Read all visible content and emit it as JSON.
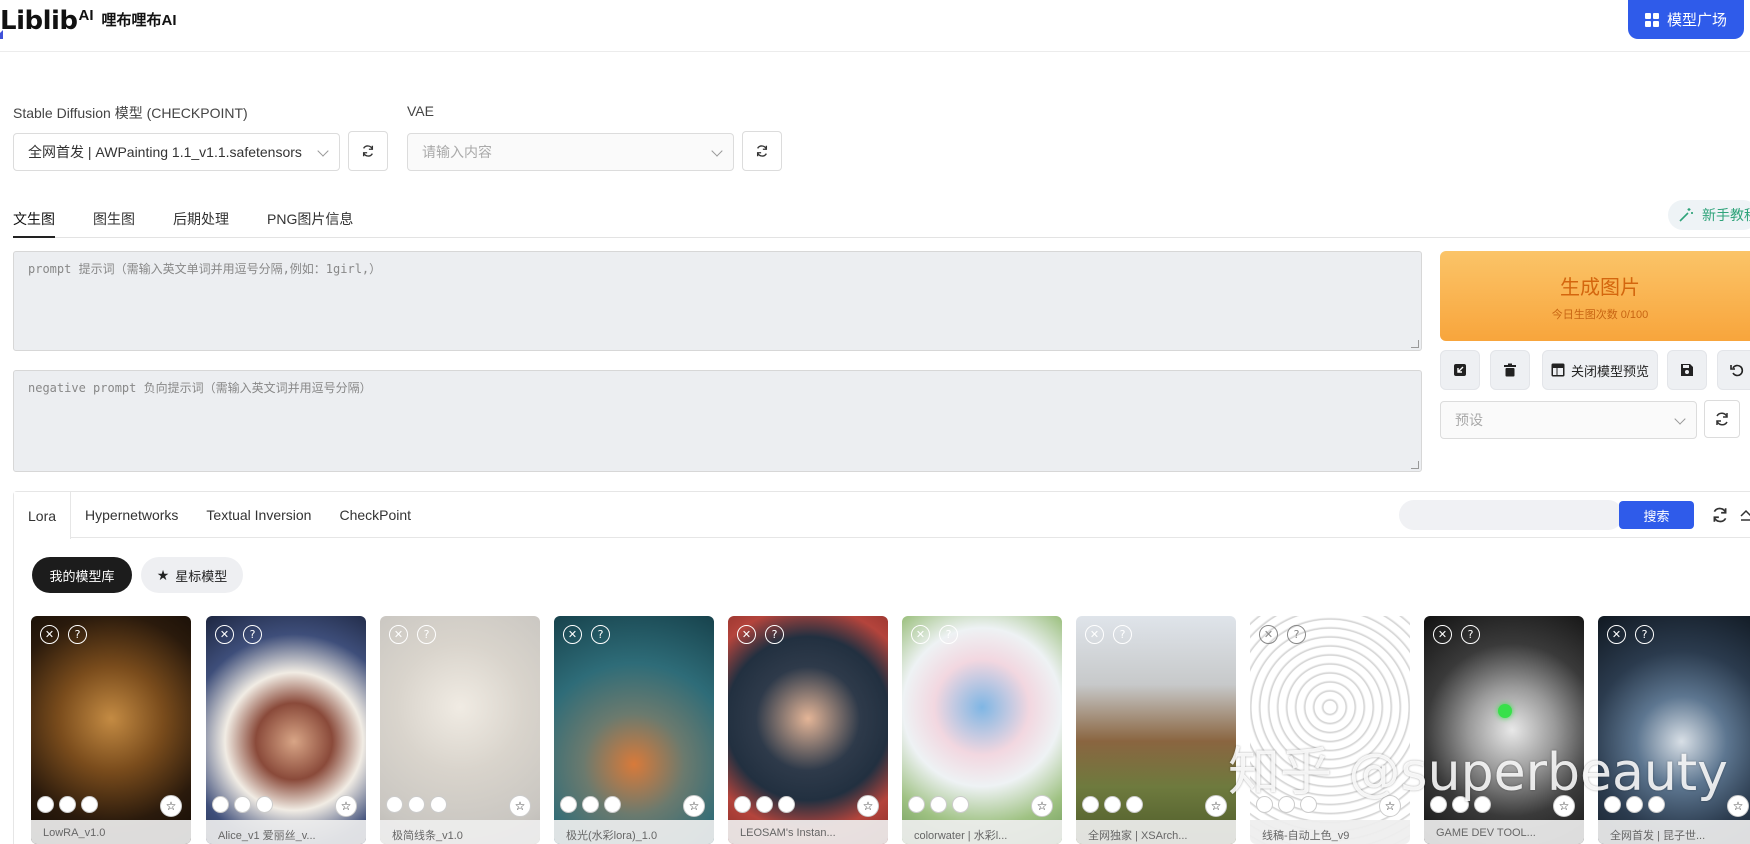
{
  "header": {
    "logo": "Liblib",
    "logo_ai": "AI",
    "logo_cn": "哩布哩布AI",
    "model_square": "模型广场"
  },
  "checkpoint": {
    "label": "Stable Diffusion 模型 (CHECKPOINT)",
    "value": "全网首发 | AWPainting 1.1_v1.1.safetensors"
  },
  "vae": {
    "label": "VAE",
    "placeholder": "请输入内容"
  },
  "tabs": [
    "文生图",
    "图生图",
    "后期处理",
    "PNG图片信息"
  ],
  "tutorial": "新手教程",
  "prompt": {
    "placeholder": "prompt 提示词（需输入英文单词并用逗号分隔,例如：1girl,）"
  },
  "negative_prompt": {
    "placeholder": "negative prompt 负向提示词（需输入英文词并用逗号分隔）"
  },
  "generate": {
    "title": "生成图片",
    "subtitle": "今日生图次数 0/100"
  },
  "toolbar": {
    "close_preview": "关闭模型预览"
  },
  "preset": {
    "placeholder": "预设"
  },
  "library": {
    "tabs": [
      "Lora",
      "Hypernetworks",
      "Textual Inversion",
      "CheckPoint"
    ],
    "search_button": "搜索",
    "my_models": "我的模型库",
    "starred": "星标模型"
  },
  "cards": [
    {
      "label": "LowRA_v1.0"
    },
    {
      "label": "Alice_v1 爱丽丝_v..."
    },
    {
      "label": "极简线条_v1.0"
    },
    {
      "label": "极光(水彩lora)_1.0"
    },
    {
      "label": "LEOSAM's Instan..."
    },
    {
      "label": "colorwater | 水彩l..."
    },
    {
      "label": "全网独家 | XSArch..."
    },
    {
      "label": "线稿-自动上色_v9"
    },
    {
      "label": "GAME DEV TOOL..."
    },
    {
      "label": "全网首发 | 昆子世..."
    }
  ],
  "watermark": "知乎 @superbeauty",
  "colors": {
    "primary": "#2f5bea",
    "generate_top": "#fbc468",
    "generate_bottom": "#f8a53c",
    "tutorial": "#2fa37a"
  }
}
